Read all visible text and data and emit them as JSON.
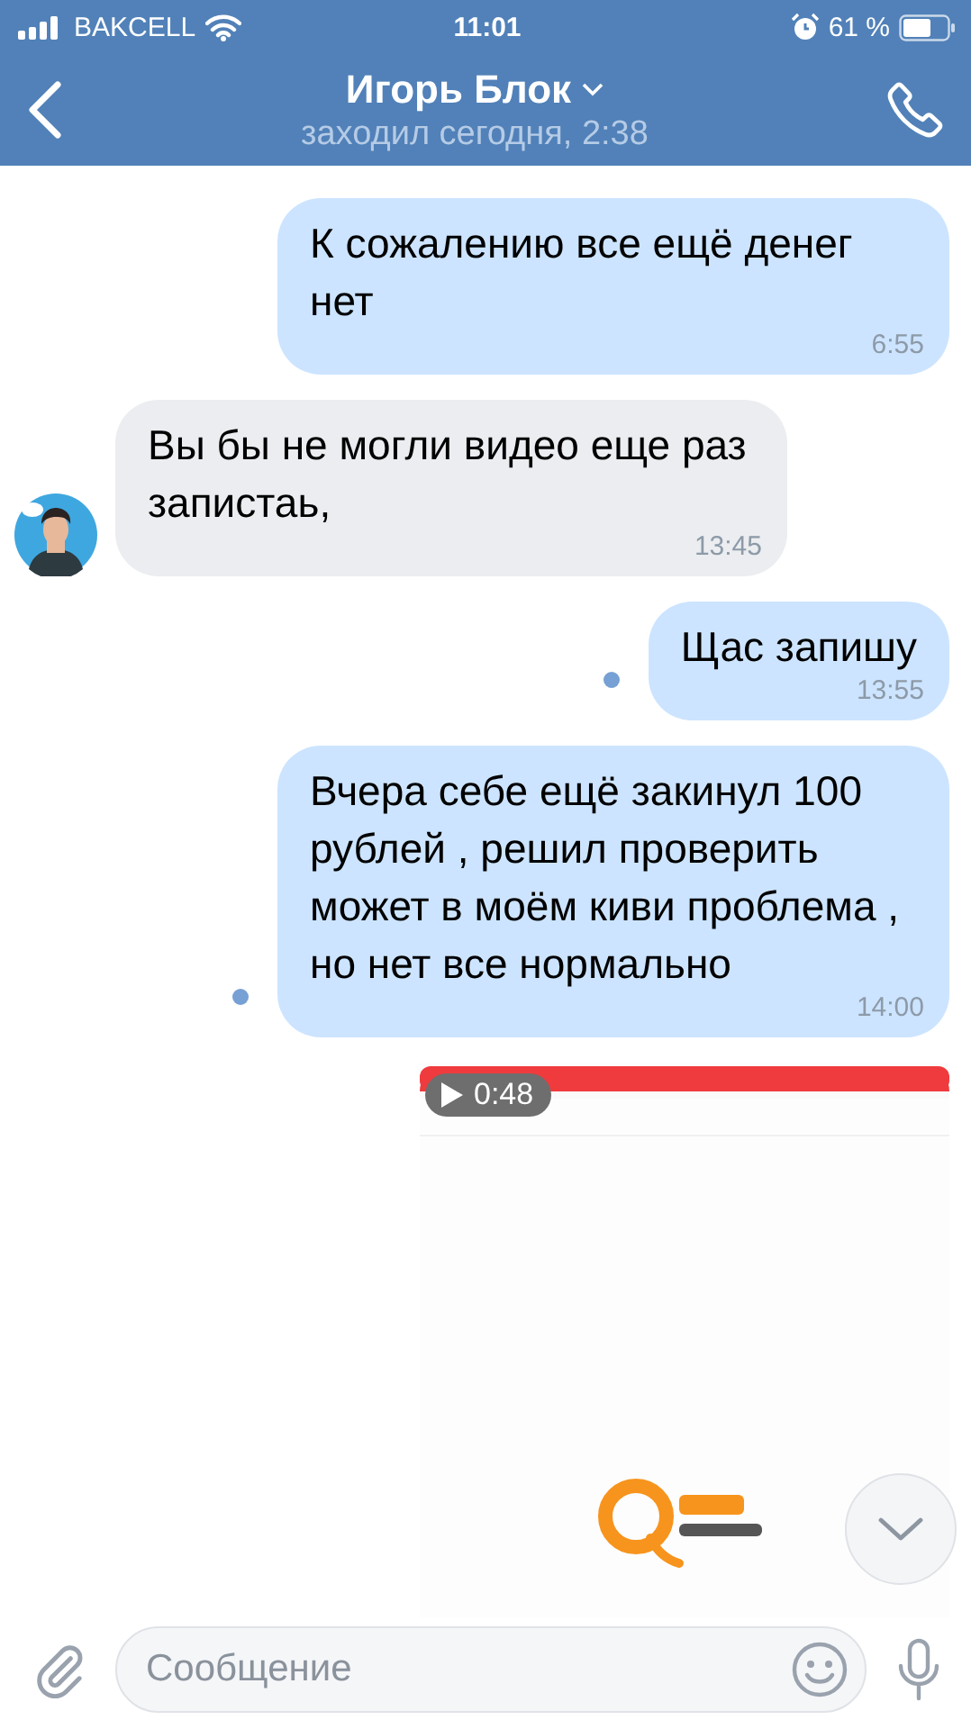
{
  "status_bar": {
    "carrier": "BAKCELL",
    "time": "11:01",
    "battery": "61 %"
  },
  "header": {
    "title": "Игорь Блок",
    "subtitle": "заходил сегодня, 2:38"
  },
  "messages": [
    {
      "kind": "text",
      "outgoing": true,
      "unread": false,
      "text": "К сожалению все ещё денег нет",
      "time": "6:55"
    },
    {
      "kind": "text",
      "outgoing": false,
      "unread": false,
      "text": "Вы бы не могли видео еще раз запистаь,",
      "time": "13:45"
    },
    {
      "kind": "text",
      "outgoing": true,
      "unread": true,
      "text": "Щас запишу",
      "time": "13:55"
    },
    {
      "kind": "text",
      "outgoing": true,
      "unread": true,
      "text": "Вчера себе ещё закинул 100 рублей , решил проверить может в моём киви проблема , но нет все нормально",
      "time": "14:00"
    },
    {
      "kind": "video",
      "outgoing": true,
      "unread": false,
      "duration": "0:48"
    }
  ],
  "composer": {
    "placeholder": "Сообщение"
  }
}
